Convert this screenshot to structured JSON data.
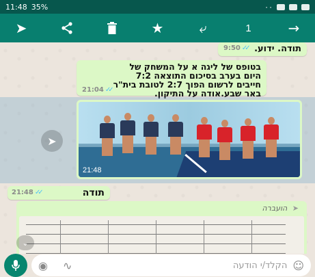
{
  "status_bar": {
    "time": "11:48",
    "battery": "35%",
    "signal_text": "۰۰"
  },
  "toolbar": {
    "selected_count": "1",
    "icons": [
      "forward-icon",
      "share-icon",
      "delete-icon",
      "star-icon",
      "reply-icon",
      "back-arrow-icon"
    ]
  },
  "messages": [
    {
      "text": "תודה. ידוע.",
      "time": "9:50",
      "ticks": "✓✓"
    },
    {
      "line1": "בטופס של ליגה א על המשחק של",
      "line2": "היום בערב בסיכום התוצאה 7:2",
      "line3": "חייבים לרשום הפוך 2:7 לטובת בית\"ר",
      "line4": "באר שבע.אודה על התיקון.",
      "time": "21:04",
      "ticks": "✓✓"
    },
    {
      "type": "image",
      "time": "21:48"
    },
    {
      "text": "תודה",
      "time": "21:48",
      "ticks": "✓✓"
    },
    {
      "type": "document",
      "forwarded_label": "הועברה"
    }
  ],
  "input": {
    "placeholder": "הקלד/י הודעה"
  },
  "colors": {
    "header": "#087f6f",
    "statusbar": "#07574d",
    "bubble_out": "#dcf8c6",
    "tick_blue": "#4fc3f7"
  }
}
